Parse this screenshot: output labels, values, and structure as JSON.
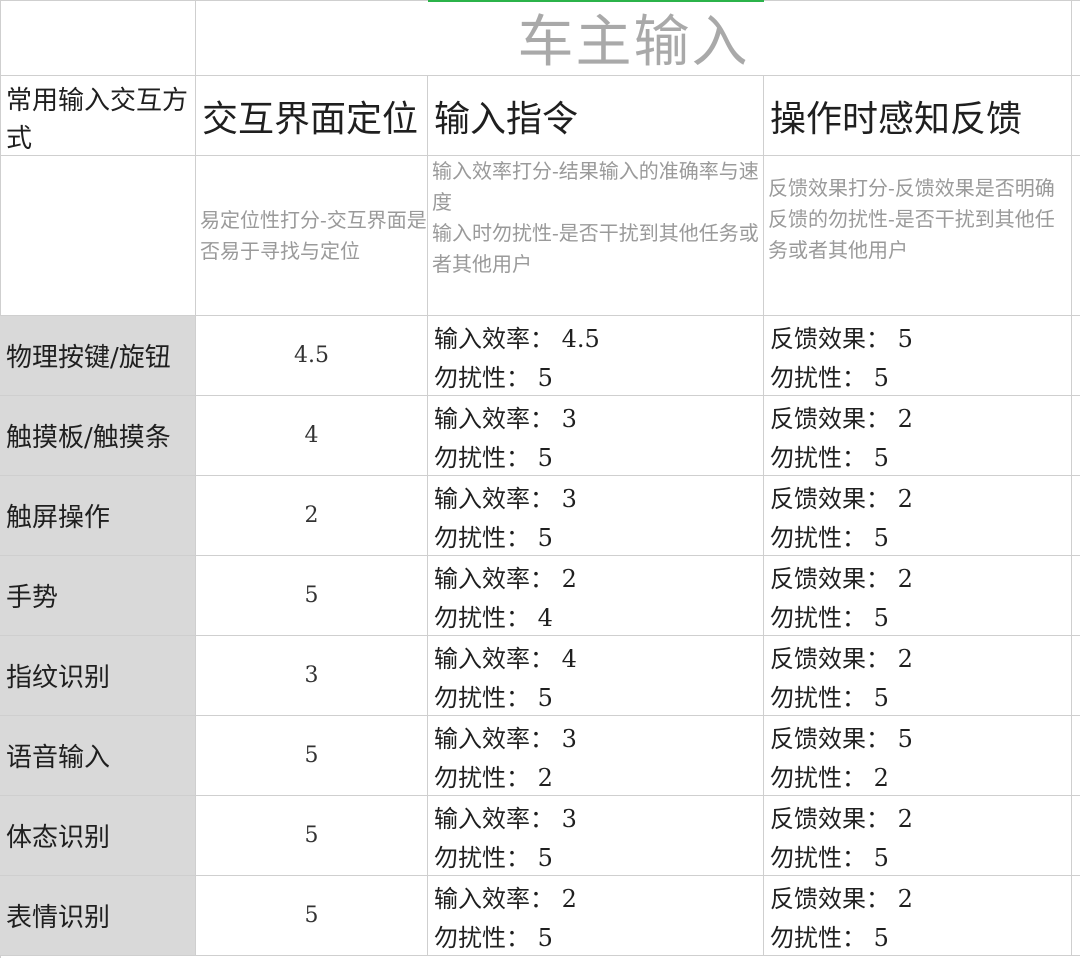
{
  "title": "车主输入",
  "header": {
    "col0": "常用输入交互方式",
    "col1": "交互界面定位",
    "col2": "输入指令",
    "col3": "操作时感知反馈"
  },
  "descriptions": {
    "col1": "易定位性打分-交互界面是否易于寻找与定位",
    "col2_line1": "输入效率打分-结果输入的准确率与速度",
    "col2_line2": "输入时勿扰性-是否干扰到其他任务或者其他用户",
    "col3_line1": "反馈效果打分-反馈效果是否明确",
    "col3_line2": "反馈的勿扰性-是否干扰到其他任务或者其他用户"
  },
  "rows": [
    {
      "method": "物理按键/旋钮",
      "locate": "4.5",
      "input_eff": "输入效率： 4.5",
      "input_dnd": "勿扰性： 5",
      "fb_eff": "反馈效果： 5",
      "fb_dnd": "勿扰性： 5"
    },
    {
      "method": "触摸板/触摸条",
      "locate": "4",
      "input_eff": "输入效率： 3",
      "input_dnd": "勿扰性： 5",
      "fb_eff": "反馈效果： 2",
      "fb_dnd": "勿扰性： 5"
    },
    {
      "method": "触屏操作",
      "locate": "2",
      "input_eff": "输入效率： 3",
      "input_dnd": "勿扰性： 5",
      "fb_eff": "反馈效果： 2",
      "fb_dnd": "勿扰性： 5"
    },
    {
      "method": "手势",
      "locate": "5",
      "input_eff": "输入效率： 2",
      "input_dnd": "勿扰性： 4",
      "fb_eff": "反馈效果： 2",
      "fb_dnd": "勿扰性： 5"
    },
    {
      "method": "指纹识别",
      "locate": "3",
      "input_eff": "输入效率： 4",
      "input_dnd": "勿扰性： 5",
      "fb_eff": "反馈效果： 2",
      "fb_dnd": "勿扰性： 5"
    },
    {
      "method": "语音输入",
      "locate": "5",
      "input_eff": "输入效率： 3",
      "input_dnd": "勿扰性： 2",
      "fb_eff": "反馈效果： 5",
      "fb_dnd": "勿扰性： 2"
    },
    {
      "method": "体态识别",
      "locate": "5",
      "input_eff": "输入效率： 3",
      "input_dnd": "勿扰性： 5",
      "fb_eff": "反馈效果： 2",
      "fb_dnd": "勿扰性： 5"
    },
    {
      "method": "表情识别",
      "locate": "5",
      "input_eff": "输入效率： 2",
      "input_dnd": "勿扰性： 5",
      "fb_eff": "反馈效果： 2",
      "fb_dnd": "勿扰性： 5"
    }
  ]
}
